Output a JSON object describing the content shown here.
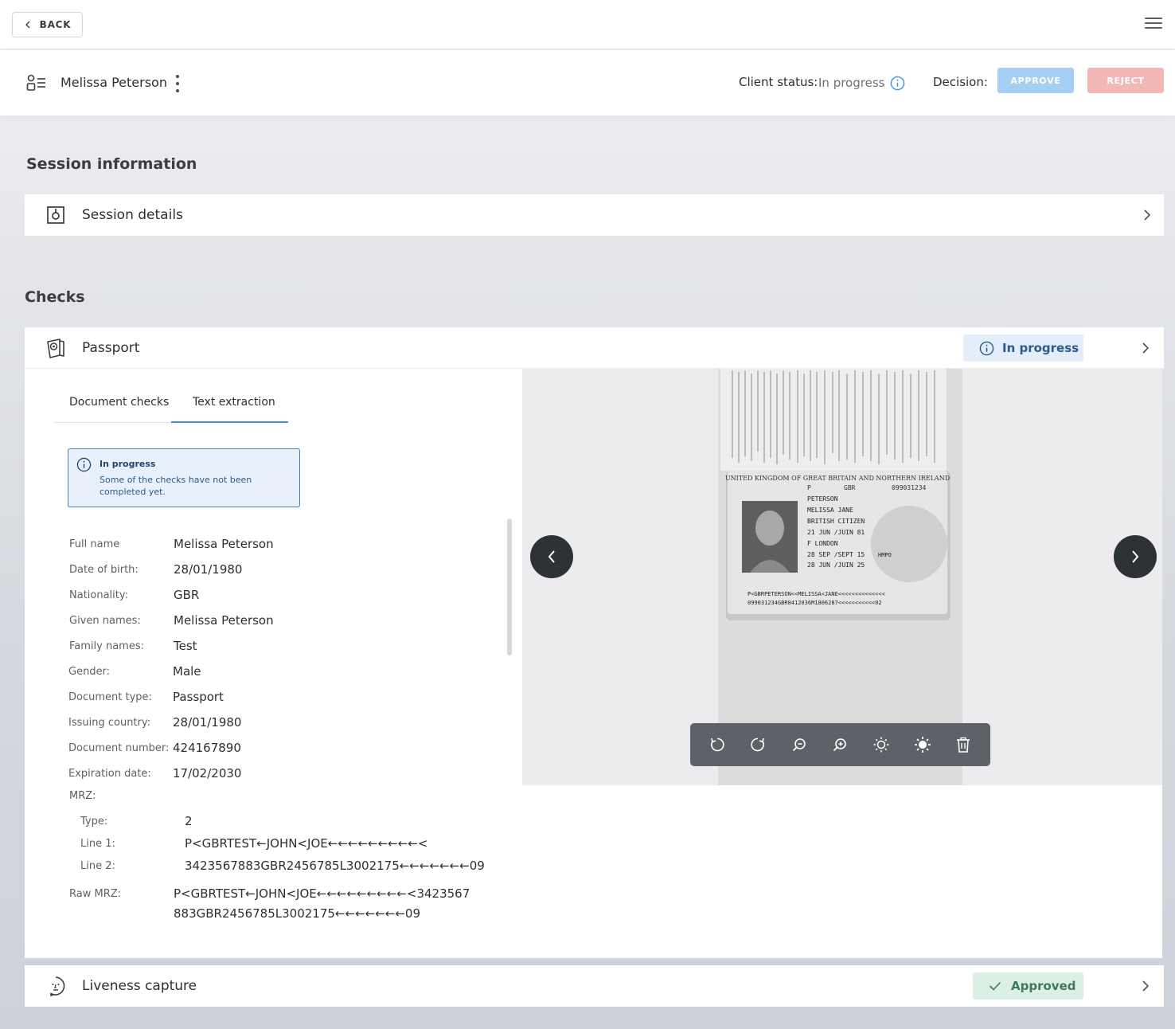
{
  "topbar": {
    "back_label": "BACK"
  },
  "client": {
    "name": "Melissa Peterson",
    "status_label": "Client status:",
    "status_value": "In progress",
    "decision_label": "Decision:",
    "approve_label": "APPROVE",
    "reject_label": "REJECT"
  },
  "session": {
    "section_title": "Session information",
    "details_label": "Session details"
  },
  "checks": {
    "section_title": "Checks",
    "passport": {
      "label": "Passport",
      "status": "In progress",
      "tabs": [
        "Document checks",
        "Text extraction"
      ],
      "alert": {
        "title": "In progress",
        "text": "Some of the checks have not been completed yet."
      },
      "fields": {
        "full_name": {
          "label": "Full name",
          "value": "Melissa Peterson"
        },
        "dob": {
          "label": "Date of birth:",
          "value": "28/01/1980"
        },
        "nationality": {
          "label": "Nationality:",
          "value": "GBR"
        },
        "given_names": {
          "label": "Given names:",
          "value": "Melissa Peterson"
        },
        "family_names": {
          "label": "Family names:",
          "value": "Test"
        },
        "gender": {
          "label": "Gender:",
          "value": "Male"
        },
        "doc_type": {
          "label": "Document type:",
          "value": "Passport"
        },
        "issuing_country": {
          "label": "Issuing country:",
          "value": "28/01/1980"
        },
        "doc_number": {
          "label": "Document number:",
          "value": "424167890"
        },
        "expiration": {
          "label": "Expiration date:",
          "value": "17/02/2030"
        }
      },
      "mrz": {
        "label": "MRZ:",
        "type_label": "Type:",
        "type_value": "2",
        "line1_label": "Line 1:",
        "line1_value": "P<GBRTEST←JOHN<JOE←←←←←←←←←<",
        "line2_label": "Line 2:",
        "line2_value": "3423567883GBR2456785L3002175←←←←←←←09",
        "raw_label": "Raw MRZ:",
        "raw_line1": "P<GBRTEST←JOHN<JOE←←←←←←←←←<3423567",
        "raw_line2": "883GBR2456785L3002175←←←←←←←09"
      },
      "document_image": {
        "header": "UNITED KINGDOM OF GREAT BRITAIN AND NORTHERN IRELAND",
        "surname": "PETERSON",
        "given": "MELISSA JANE",
        "nationality": "BRITISH CITIZEN",
        "dob": "21 JUN /JUIN 81",
        "sex_place": "F     LONDON",
        "issue": "28 SEP /SEPT 15",
        "authority": "HMPO",
        "expiry": "28 JUN /JUIN 25",
        "type": "P",
        "code": "GBR",
        "number": "099031234",
        "mrz1": "P<GBRPETERSON<<MELISSA<JANE<<<<<<<<<<<<<<",
        "mrz2": "099031234GBR8412036M1806287<<<<<<<<<<<02"
      }
    },
    "liveness": {
      "label": "Liveness capture",
      "status": "Approved"
    }
  },
  "icons": {
    "back": "chevron-left-icon",
    "menu": "hamburger-menu-icon",
    "client": "user-list-icon",
    "more": "kebab-icon",
    "info": "info-icon",
    "session": "session-icon",
    "passport": "passport-icon",
    "liveness": "face-icon",
    "chevron": "chevron-right-icon",
    "check": "check-icon",
    "tools": [
      "rotate-left-icon",
      "rotate-right-icon",
      "zoom-out-icon",
      "zoom-in-icon",
      "brightness-down-icon",
      "brightness-up-icon",
      "delete-icon"
    ]
  },
  "colors": {
    "accent": "#4a8fd8",
    "approve": "#a7cff3",
    "reject": "#f2b8b8",
    "progress_badge_bg": "#e3eefa",
    "approved_badge_bg": "#dcefe4"
  }
}
